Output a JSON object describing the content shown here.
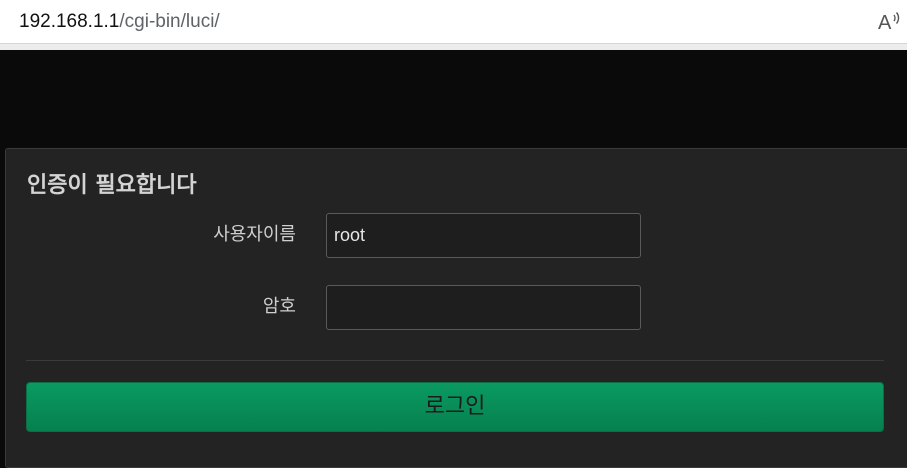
{
  "browser": {
    "url_host": "192.168.1.1",
    "url_path": "/cgi-bin/luci/",
    "read_aloud_icon": "read-aloud-icon"
  },
  "login": {
    "title": "인증이 필요합니다",
    "username_label": "사용자이름",
    "username_value": "root",
    "password_label": "암호",
    "password_value": "",
    "submit_label": "로그인"
  },
  "colors": {
    "page_background": "#0a0a0a",
    "panel_background": "#232323",
    "accent_button": "#088a58"
  }
}
